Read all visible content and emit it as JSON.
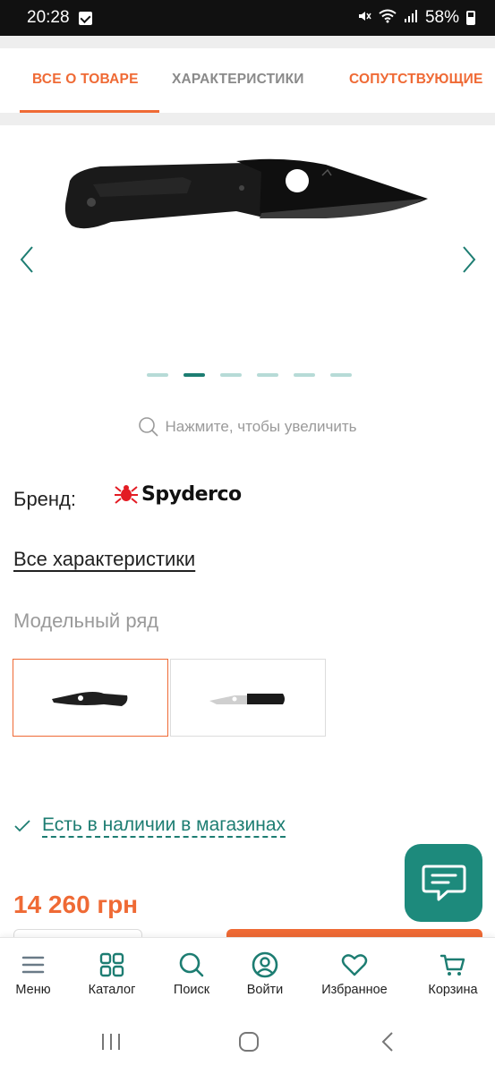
{
  "status_bar": {
    "time": "20:28",
    "battery": "58%"
  },
  "tabs": [
    {
      "label": "ВСЕ О ТОВАРЕ",
      "active": true
    },
    {
      "label": "ХАРАКТЕРИСТИКИ",
      "active": false
    },
    {
      "label": "СОПУТСТВУЮЩИЕ",
      "active": false
    }
  ],
  "gallery": {
    "dot_count": 6,
    "active_dot": 2,
    "zoom_hint": "Нажмите, чтобы увеличить"
  },
  "brand": {
    "label": "Бренд:",
    "logo_text": "Spyderco"
  },
  "all_specs_link": "Все характеристики",
  "model_range": {
    "title": "Модельный ряд",
    "selected_index": 1
  },
  "stock": {
    "text": "Есть в наличии в магазинах"
  },
  "price": "14 260 грн",
  "bottom_nav": [
    {
      "label": "Меню",
      "icon": "menu-icon"
    },
    {
      "label": "Каталог",
      "icon": "grid-icon"
    },
    {
      "label": "Поиск",
      "icon": "search-icon"
    },
    {
      "label": "Войти",
      "icon": "user-icon"
    },
    {
      "label": "Избранное",
      "icon": "heart-icon"
    },
    {
      "label": "Корзина",
      "icon": "cart-icon"
    }
  ],
  "colors": {
    "accent": "#ef6a35",
    "teal": "#1d7d72",
    "teal_light": "#b7dbd7"
  }
}
